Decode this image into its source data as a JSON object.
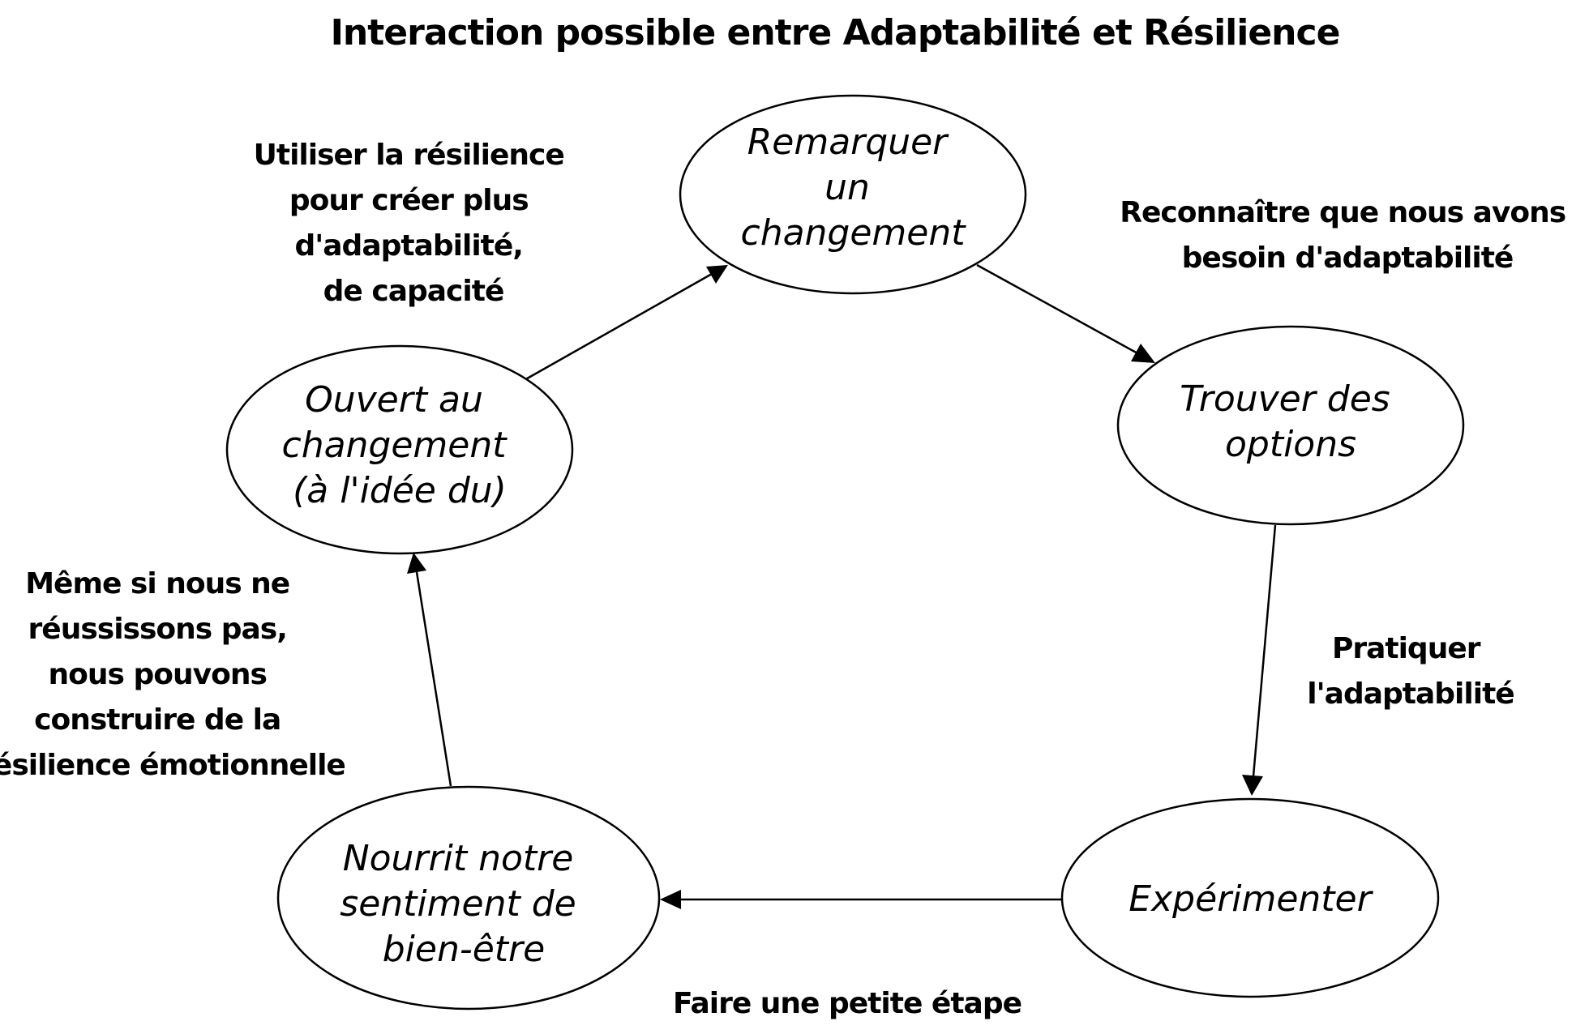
{
  "title": "Interaction possible entre Adaptabilité et Résilience",
  "nodes": [
    {
      "id": "remarquer",
      "lines": [
        "Remarquer",
        "un",
        "changement"
      ]
    },
    {
      "id": "trouver",
      "lines": [
        "Trouver des",
        "options"
      ]
    },
    {
      "id": "experimenter",
      "lines": [
        "Expérimenter"
      ]
    },
    {
      "id": "nourrit",
      "lines": [
        "Nourrit notre",
        "sentiment de",
        "bien-être"
      ]
    },
    {
      "id": "ouvert",
      "lines": [
        "Ouvert au",
        "changement",
        "(à l'idée du)"
      ]
    }
  ],
  "annotations": [
    {
      "id": "utiliser",
      "lines": [
        "Utiliser la résilience",
        "pour créer plus",
        "d'adaptabilité,",
        "de capacité"
      ]
    },
    {
      "id": "reconnaitre",
      "lines": [
        "Reconnaître que nous avons",
        "besoin d'adaptabilité"
      ]
    },
    {
      "id": "pratiquer",
      "lines": [
        "Pratiquer",
        "l'adaptabilité"
      ]
    },
    {
      "id": "faire",
      "lines": [
        "Faire une petite étape"
      ]
    },
    {
      "id": "meme",
      "lines": [
        "Même si nous ne",
        "réussissons pas,",
        "nous pouvons",
        "construire de la",
        "résilience émotionnelle"
      ]
    }
  ],
  "edges": [
    {
      "from": "remarquer",
      "to": "trouver"
    },
    {
      "from": "trouver",
      "to": "experimenter"
    },
    {
      "from": "experimenter",
      "to": "nourrit"
    },
    {
      "from": "nourrit",
      "to": "ouvert"
    },
    {
      "from": "ouvert",
      "to": "remarquer"
    }
  ]
}
